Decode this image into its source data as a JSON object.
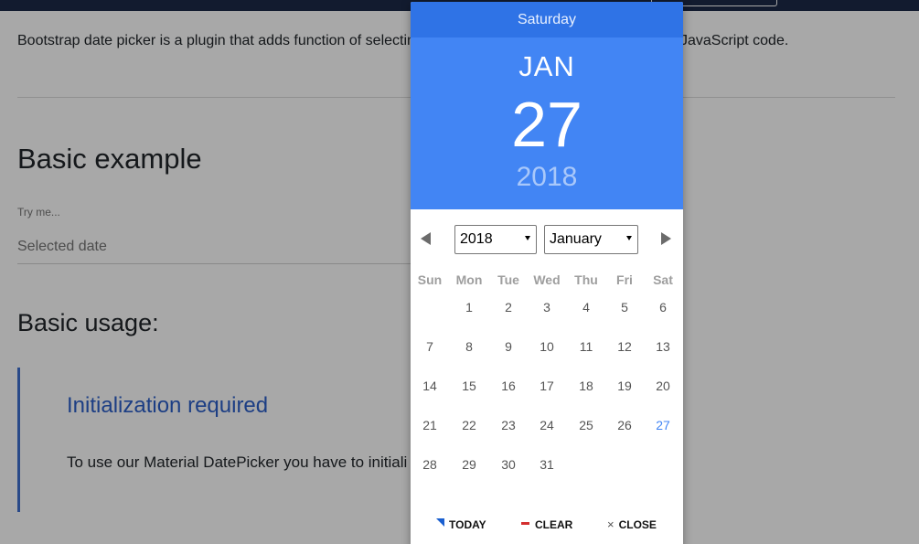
{
  "page": {
    "intro_start": "Bootstrap date picker is a plugin that adds function of selectin",
    "intro_end": "JavaScript code.",
    "basic_example_heading": "Basic example",
    "try_label": "Try me...",
    "date_placeholder": "Selected date",
    "basic_usage_heading": "Basic usage:",
    "note_title": "Initialization required",
    "note_text": "To use our Material DatePicker you have to initiali"
  },
  "datepicker": {
    "weekday": "Saturday",
    "month_short": "JAN",
    "day": "27",
    "year": "2018",
    "year_select": "2018",
    "month_select": "January",
    "dow": [
      "Sun",
      "Mon",
      "Tue",
      "Wed",
      "Thu",
      "Fri",
      "Sat"
    ],
    "weeks": [
      [
        "",
        "1",
        "2",
        "3",
        "4",
        "5",
        "6"
      ],
      [
        "7",
        "8",
        "9",
        "10",
        "11",
        "12",
        "13"
      ],
      [
        "14",
        "15",
        "16",
        "17",
        "18",
        "19",
        "20"
      ],
      [
        "21",
        "22",
        "23",
        "24",
        "25",
        "26",
        "27"
      ],
      [
        "28",
        "29",
        "30",
        "31",
        "",
        "",
        ""
      ]
    ],
    "selected_day": "27",
    "today_label": "TODAY",
    "clear_label": "CLEAR",
    "close_label": "CLOSE",
    "close_glyph": "×"
  },
  "colors": {
    "header_bar": "#2f73e6",
    "header_body": "#4285f4",
    "accent": "#4285f4",
    "clear_icon": "#d32f2f",
    "today_icon": "#1a5fd0",
    "note_title": "#2b5ec9"
  },
  "icons": {
    "prev": "chevron-left-icon",
    "next": "chevron-right-icon",
    "today": "today-triangle-icon",
    "clear": "clear-dash-icon",
    "close": "close-x-icon"
  }
}
